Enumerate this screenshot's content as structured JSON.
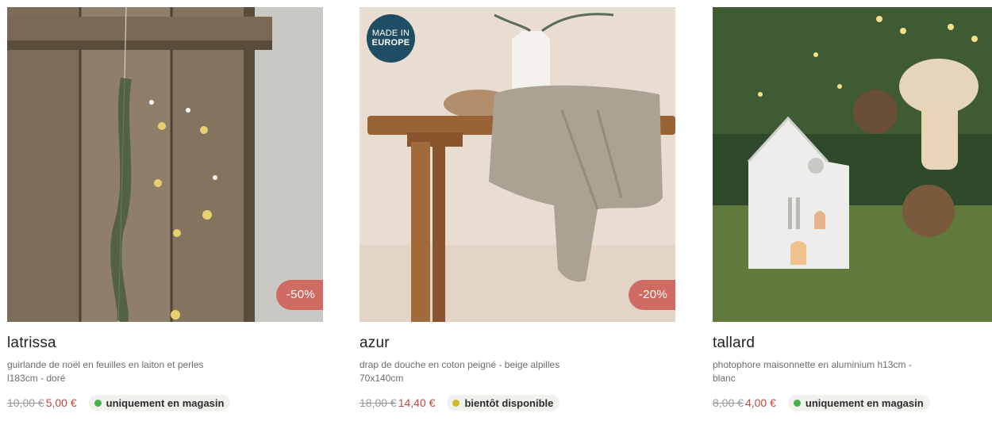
{
  "colors": {
    "discount_badge": "#cf6b62",
    "new_price": "#c0483f",
    "in_store_dot": "#4caf50",
    "coming_soon_dot": "#d4b82a",
    "made_in_europe_badge": "#1f4d63"
  },
  "products": [
    {
      "name": "latrissa",
      "description": "guirlande de noël en feuilles en laiton et perles l183cm - doré",
      "old_price": "10,00 €",
      "new_price": "5,00 €",
      "discount": "-50%",
      "availability": "uniquement en magasin",
      "availability_icon": "green-dot-icon",
      "image": "brass-leaf-garland-on-wooden-door"
    },
    {
      "name": "azur",
      "description": "drap de douche en coton peigné - beige alpilles 70x140cm",
      "old_price": "18,00 €",
      "new_price": "14,40 €",
      "discount": "-20%",
      "availability": "bientôt disponible",
      "availability_icon": "yellow-dot-icon",
      "badge": {
        "line1": "MADE IN",
        "line2": "EUROPE"
      },
      "image": "beige-towel-on-wooden-bench"
    },
    {
      "name": "tallard",
      "description": "photophore maisonnette en aluminium h13cm - blanc",
      "old_price": "8,00 €",
      "new_price": "4,00 €",
      "availability": "uniquement en magasin",
      "availability_icon": "green-dot-icon",
      "image": "white-house-lantern-on-moss"
    }
  ]
}
